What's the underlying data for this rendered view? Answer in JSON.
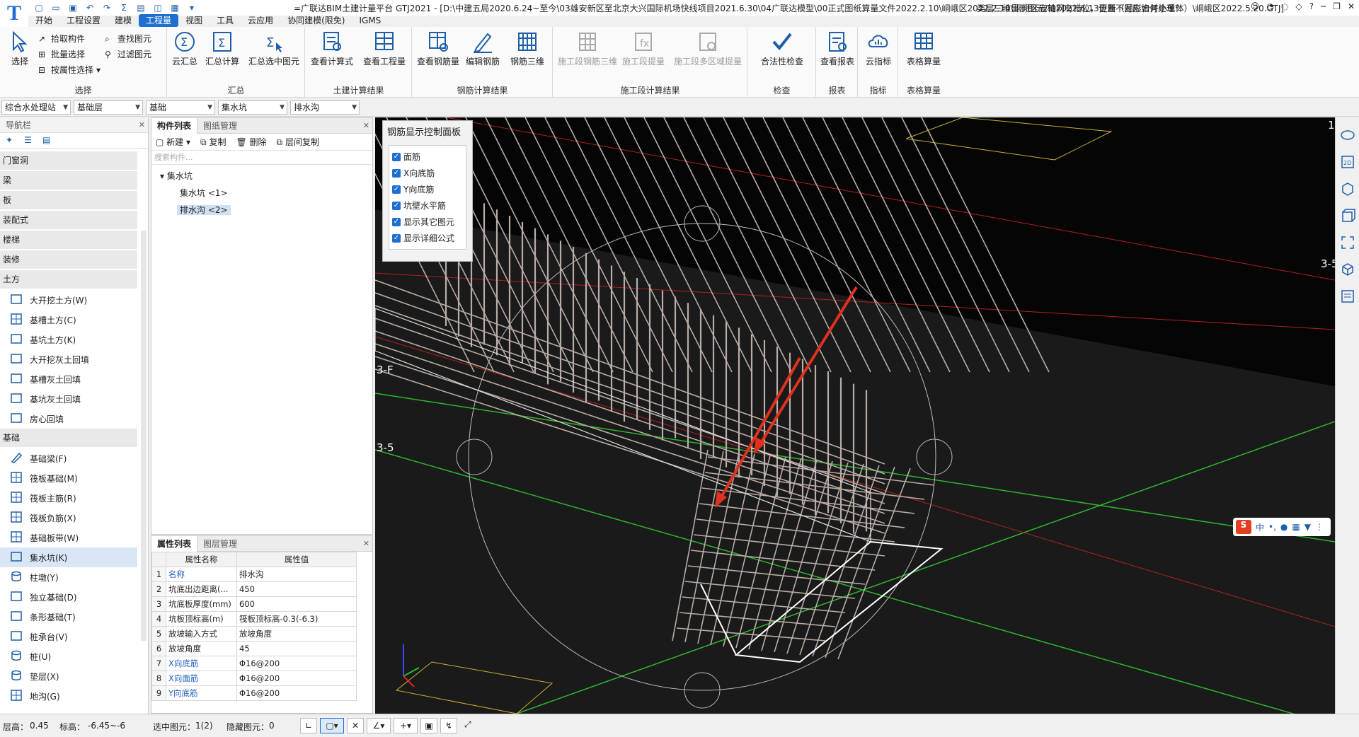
{
  "titlebar": {
    "title": "=广联达BIM土建计量平台 GTJ2021 - [D:\\中建五局2020.6.24~至今\\03雄安新区至北京大兴国际机场快线项目2021.6.30\\04广联达模型\\00正式图纸算量文件2022.2.10\\峒峨区2022.2.10\\峒峨区庞椅2022.6.13更新（图形合并小单体）\\峒峨区2022.5.20.GTJ]",
    "hint": "类层三维显示图元/轴网有错位，位置不对应如何处理？"
  },
  "menu": [
    "开始",
    "工程设置",
    "建模",
    "工程量",
    "视图",
    "工具",
    "云应用",
    "协同建模(限免)",
    "IGMS"
  ],
  "menu_active": "工程量",
  "ribbon": {
    "select_group": {
      "label": "选择",
      "select": "选择",
      "pick": "拾取构件",
      "batch": "批量选择",
      "by_attr": "按属性选择",
      "find": "查找图元",
      "filter": "过滤图元"
    },
    "summary_group": {
      "label": "汇总",
      "cloud_sum": "云汇总",
      "sum_calc": "汇总计算",
      "sum_selected": "汇总选中图元"
    },
    "civil_group": {
      "label": "土建计算结果",
      "view_formula": "查看计算式",
      "view_qty": "查看工程量"
    },
    "rebar_group": {
      "label": "钢筋计算结果",
      "view_rebar": "查看钢筋量",
      "edit_rebar": "编辑钢筋",
      "rebar_3d": "钢筋三维"
    },
    "construct_group": {
      "label": "施工段计算结果",
      "seg_rebar_3d": "施工段钢筋三维",
      "seg_extract": "施工段提量",
      "seg_multi": "施工段多区域提量"
    },
    "check_group": {
      "label": "检查",
      "legal_check": "合法性检查"
    },
    "report_group": {
      "label": "报表",
      "view_report": "查看报表"
    },
    "index_group": {
      "label": "指标",
      "cloud_index": "云指标"
    },
    "table_group": {
      "label": "表格算量",
      "table_calc": "表格算量"
    }
  },
  "filters": [
    "综合水处理站",
    "基础层",
    "基础",
    "集水坑",
    "排水沟"
  ],
  "nav": {
    "title": "导航栏",
    "categories_top": [
      "门窗洞",
      "梁",
      "板",
      "装配式",
      "楼梯",
      "装修",
      "土方"
    ],
    "earth_items": [
      "大开挖土方(W)",
      "基槽土方(C)",
      "基坑土方(K)",
      "大开挖灰土回填",
      "基槽灰土回填",
      "基坑灰土回填",
      "房心回填"
    ],
    "foundation_label": "基础",
    "foundation_items": [
      "基础梁(F)",
      "筏板基础(M)",
      "筏板主筋(R)",
      "筏板负筋(X)",
      "基础板带(W)",
      "集水坑(K)",
      "柱墩(Y)",
      "独立基础(D)",
      "条形基础(T)",
      "桩承台(V)",
      "桩(U)",
      "垫层(X)",
      "地沟(G)"
    ],
    "selected": "集水坑(K)"
  },
  "components": {
    "tabs": [
      "构件列表",
      "图纸管理"
    ],
    "tools": [
      "新建",
      "复制",
      "删除",
      "层间复制"
    ],
    "search_placeholder": "搜索构件...",
    "tree_root": "集水坑",
    "tree_children": [
      "集水坑 <1>",
      "排水沟 <2>"
    ],
    "selected": "排水沟 <2>"
  },
  "properties": {
    "tabs": [
      "属性列表",
      "图层管理"
    ],
    "headers": [
      "属性名称",
      "属性值"
    ],
    "rows": [
      [
        "1",
        "名称",
        "排水沟"
      ],
      [
        "2",
        "坑底出边距离(...",
        "450"
      ],
      [
        "3",
        "坑底板厚度(mm)",
        "600"
      ],
      [
        "4",
        "坑板顶标高(m)",
        "筏板顶标高-0.3(-6.3)"
      ],
      [
        "5",
        "放坡输入方式",
        "放坡角度"
      ],
      [
        "6",
        "放坡角度",
        "45"
      ],
      [
        "7",
        "X向底筋",
        "Φ16@200"
      ],
      [
        "8",
        "X向面筋",
        "Φ16@200"
      ],
      [
        "9",
        "Y向底筋",
        "Φ16@200"
      ]
    ]
  },
  "rebar_panel": {
    "title": "钢筋显示控制面板",
    "options": [
      "面筋",
      "X向底筋",
      "Y向底筋",
      "坑壁水平筋",
      "显示其它图元",
      "显示详细公式"
    ]
  },
  "viewport_labels": {
    "axis_3f": "3-F",
    "axis_35": "3-5",
    "axis_35r": "3-5",
    "num_1": "1"
  },
  "status": {
    "floor_height_label": "层高：",
    "floor_height": "0.45",
    "elev_label": "标高：",
    "elev": "-6.45~-6",
    "selected_label": "选中图元：",
    "selected": "1(2)",
    "hidden_label": "隐藏图元：",
    "hidden": "0"
  },
  "colors": {
    "accent": "#1f6fd1",
    "viewport_bg": "#000000",
    "arrow": "#e03020",
    "rebar": "#b9aca6",
    "grid_green": "#2db52d"
  }
}
